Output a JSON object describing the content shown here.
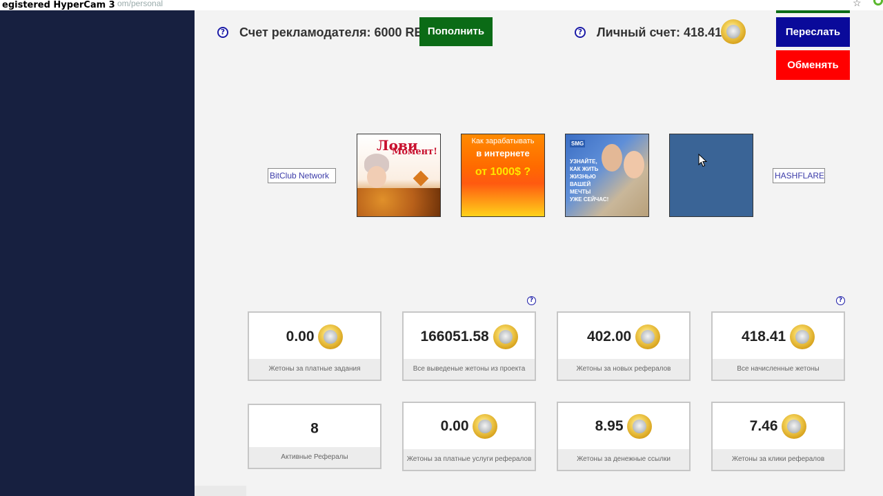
{
  "watermark": "egistered HyperCam 3",
  "browser": {
    "url": "ru.com/personal"
  },
  "header": {
    "advertiser_label": "Счет рекламодателя: 6000 RE",
    "topup_button": "Пополнить",
    "personal_label": "Личный счет: 418.41",
    "forward_button": "Переслать",
    "exchange_button": "Обменять"
  },
  "banners": {
    "left_broken_alt": "BitClub Network",
    "right_broken_alt": "HASHFLARE",
    "banner1_title": "Лови",
    "banner1_title2": "Момент!",
    "banner2_line1": "Как зарабатывать",
    "banner2_line2": "в интернете",
    "banner2_line3": "от 1000$ ?",
    "banner3_brand": "SMG",
    "banner3_line1": "УЗНАЙТЕ,",
    "banner3_line2": "КАК ЖИТЬ",
    "banner3_line3": "ЖИЗНЬЮ",
    "banner3_line4": "ВАШЕЙ",
    "banner3_line5": "МЕЧТЫ",
    "banner3_line6": "УЖЕ СЕЙЧАС!"
  },
  "stats": [
    {
      "value": "0.00",
      "label": "Жетоны за платные задания"
    },
    {
      "value": "166051.58",
      "label": "Все выведеные жетоны из проекта"
    },
    {
      "value": "402.00",
      "label": "Жетоны за новых рефералов"
    },
    {
      "value": "418.41",
      "label": "Все начисленные жетоны"
    },
    {
      "value": "8",
      "label": "Активные Рефералы"
    },
    {
      "value": "0.00",
      "label": "Жетоны за платные услуги рефералов"
    },
    {
      "value": "8.95",
      "label": "Жетоны за денежные ссылки"
    },
    {
      "value": "7.46",
      "label": "Жетоны за клики рефералов"
    }
  ],
  "help_glyph": "?",
  "icons": {
    "help": "question-circle-icon",
    "coin": "token-coin-icon",
    "cursor": "mouse-pointer-icon",
    "star": "bookmark-star-icon"
  },
  "colors": {
    "sidebar": "#172040",
    "topup": "#0b6b16",
    "forward": "#0a0a9a",
    "exchange": "#ff0000",
    "help": "#1a1aa6"
  }
}
